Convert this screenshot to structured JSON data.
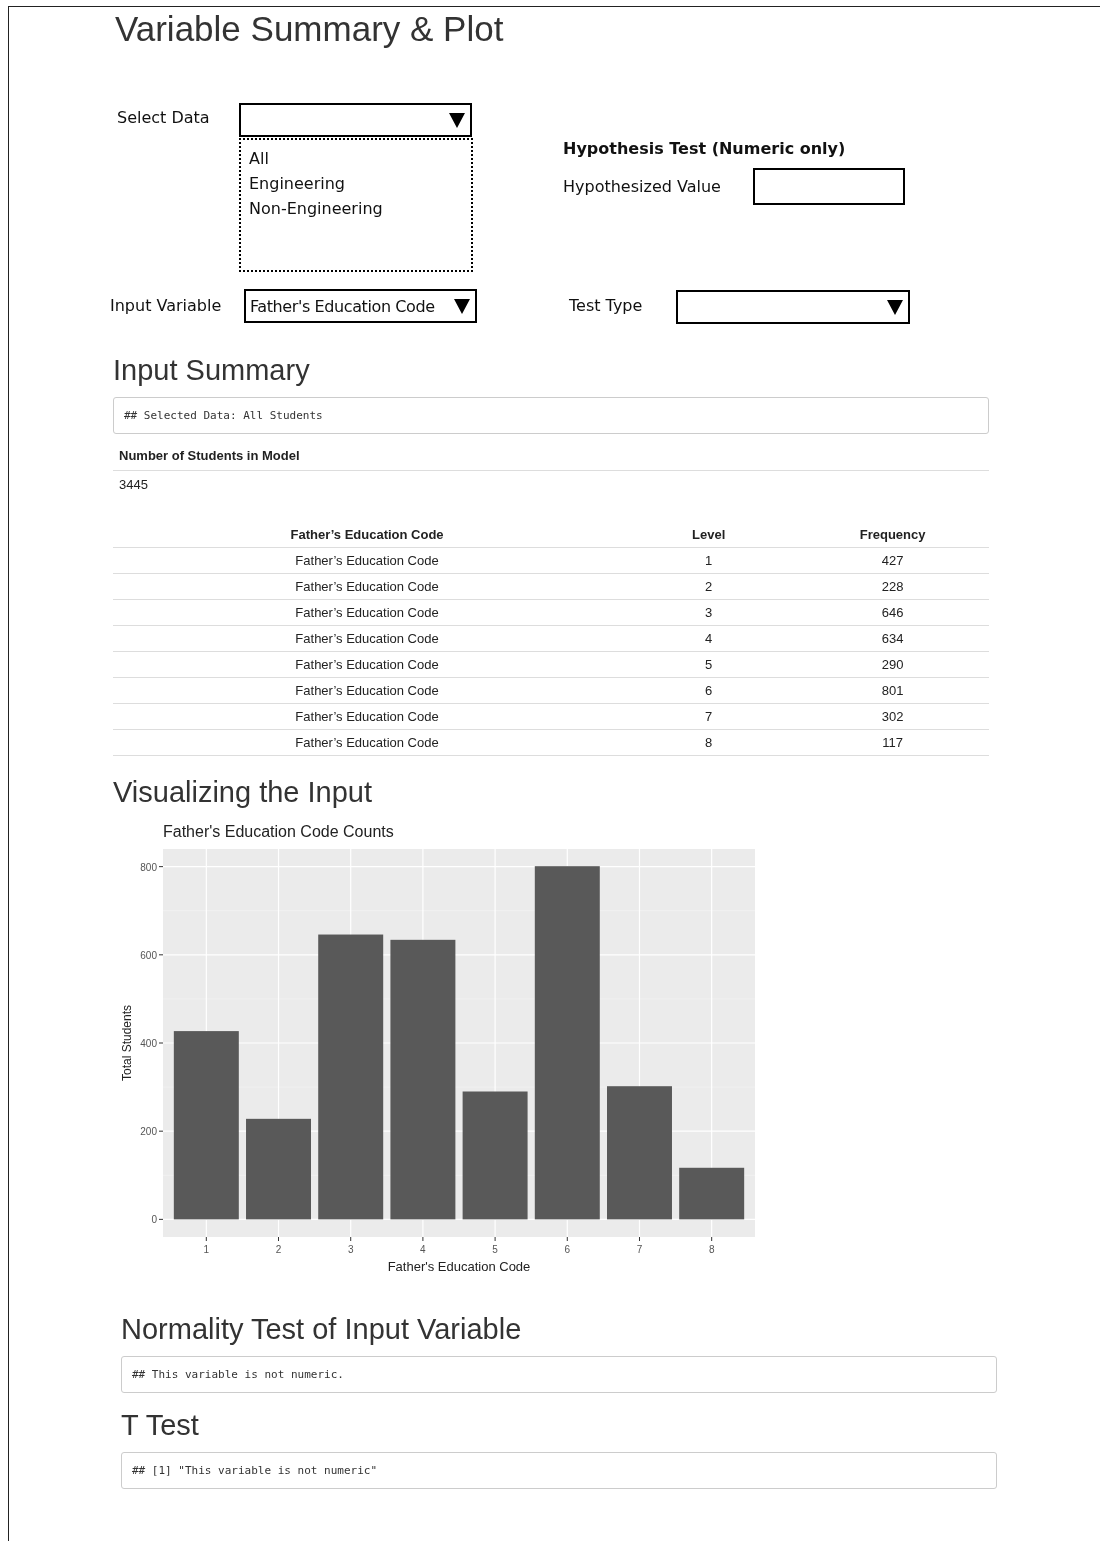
{
  "page_title": "Variable Summary & Plot",
  "controls": {
    "select_data": {
      "label": "Select Data",
      "options": [
        {
          "label": "All",
          "selected": false
        },
        {
          "label": "Engineering",
          "selected": false
        },
        {
          "label": "Non-Engineering",
          "selected": false
        }
      ]
    },
    "hypothesis_test": {
      "title": "Hypothesis Test (Numeric only)",
      "label": "Hypothesized Value"
    },
    "input_variable": {
      "label": "Input Variable",
      "value": "Father's Education Code"
    },
    "test_type": {
      "label": "Test Type"
    }
  },
  "input_summary": {
    "heading": "Input Summary",
    "output": "## Selected Data: All Students",
    "count_label": "Number of Students in Model",
    "count_value": "3445",
    "table": {
      "columns": [
        "Father’s Education Code",
        "Level",
        "Frequency"
      ],
      "rows": [
        [
          "Father’s Education Code",
          "1",
          "427"
        ],
        [
          "Father’s Education Code",
          "2",
          "228"
        ],
        [
          "Father’s Education Code",
          "3",
          "646"
        ],
        [
          "Father’s Education Code",
          "4",
          "634"
        ],
        [
          "Father’s Education Code",
          "5",
          "290"
        ],
        [
          "Father’s Education Code",
          "6",
          "801"
        ],
        [
          "Father’s Education Code",
          "7",
          "302"
        ],
        [
          "Father’s Education Code",
          "8",
          "117"
        ]
      ]
    }
  },
  "visualizing": {
    "heading": "Visualizing the Input",
    "chart_data": {
      "type": "bar",
      "title": "Father's Education Code Counts",
      "xlabel": "Father's Education Code",
      "ylabel": "Total Students",
      "categories": [
        "1",
        "2",
        "3",
        "4",
        "5",
        "6",
        "7",
        "8"
      ],
      "series": [
        {
          "color": "#595959",
          "values": [
            427,
            228,
            646,
            634,
            290,
            801,
            302,
            117
          ]
        }
      ],
      "grid": true,
      "ylim": [
        -40,
        840
      ],
      "yticks": [
        0,
        200,
        400,
        600,
        800
      ]
    }
  },
  "normality": {
    "heading": "Normality Test of Input Variable",
    "output": "## This variable is not numeric."
  },
  "t_test": {
    "heading": "T Test",
    "output": "## [1] \"This variable is not numeric\""
  }
}
